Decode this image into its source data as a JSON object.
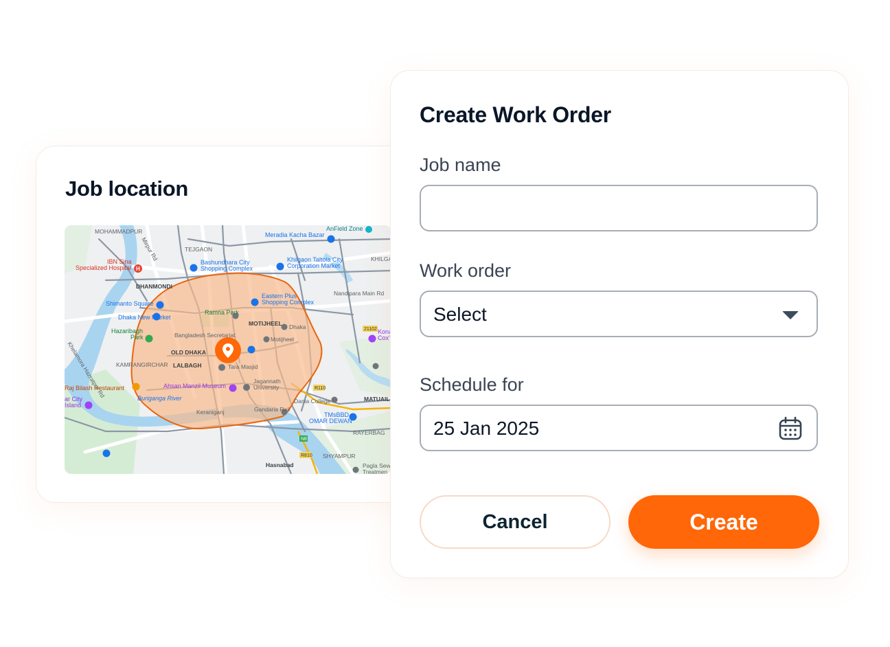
{
  "location_card": {
    "title": "Job location",
    "map_labels": {
      "mohammadpur": "MOHAMMADPUR",
      "tejgaon": "TEJGAON",
      "mirpur_rd": "Mirpur Rd",
      "ibn_sina": "IBN Sina",
      "specialized_hospital": "Specialized Hospital",
      "dhanmondi": "DHANMONDI",
      "bashundhara_city": "Bashundhara City",
      "shopping_complex": "Shopping Complex",
      "meradia_kacha_bazar": "Meradia Kacha Bazar",
      "anfield_zone": "AnField Zone",
      "khilgaon_tatola_city": "Khilgaon Taltola City",
      "corporation_market": "Corporation Market",
      "khilgaon": "KHILGAO",
      "nandipara_mainrd": "Nandipara Main Rd",
      "shimanto_square": "Shimanto Square",
      "eastern_plus": "Eastern Plus",
      "eastern_plus_2": "Shopping Complex",
      "dhaka_new_market": "Dhaka New Market",
      "ramna_park": "Ramna Park",
      "motijheel_caps": "MOTIJHEEL",
      "dhaka": "Dhaka",
      "hazaribagh": "Hazaribagh",
      "hazaribagh_park": "Park",
      "bangladesh_secretariat": "Bangladesh Secretariat",
      "motijheel": "Motijheel",
      "old_dhaka": "OLD DHAKA",
      "kamrangirchar": "KAMRANGIRCHAR",
      "lalbagh": "LALBAGH",
      "tara_masjid": "Tara Masjid",
      "jagannath": "Jagannath",
      "university": "University",
      "raj_bilash": "Raj Bilash Restaurant",
      "ahsan_manzil": "Ahsan Manzil Museum",
      "buriganga": "Buriganga River",
      "dania_college": "Dania College",
      "mataul": "MATUAIL",
      "keraniganj": "Keraniganj",
      "gandaria_rail": "Gandaria Rail",
      "tmsbbd": "TMsBBD",
      "omar_dewan": "OMAR DEWAN",
      "rayerbag": "RAYERBAG",
      "shyampur": "SHYAMPUR",
      "hasnabad": "Hasnabad",
      "pagla_sew": "Pagla Sew",
      "treatment": "Treatmen",
      "kona": "Kona",
      "coxs": "Cox'",
      "char_island": "ar City",
      "char_island_2": "Island",
      "khelamora_rd": "Khelamora Hazratpur Rd",
      "road_21102": "21102",
      "road_r110": "R110",
      "road_n8": "N8",
      "road_r810": "R810"
    }
  },
  "form": {
    "title": "Create Work Order",
    "job_name": {
      "label": "Job name",
      "value": "",
      "placeholder": ""
    },
    "work_order": {
      "label": "Work order",
      "selected": "Select"
    },
    "schedule": {
      "label": "Schedule for",
      "value": "25 Jan 2025"
    },
    "cancel_label": "Cancel",
    "create_label": "Create"
  },
  "colors": {
    "accent": "#ff6708",
    "zone_fill": "#f7b98a",
    "zone_stroke": "#e9650f"
  }
}
